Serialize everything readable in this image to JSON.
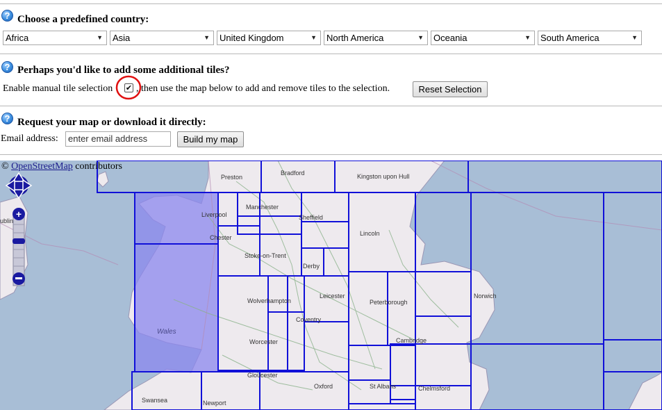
{
  "section1": {
    "title": "Choose a predefined country:"
  },
  "countries": [
    {
      "label": "Africa"
    },
    {
      "label": "Asia"
    },
    {
      "label": "United Kingdom"
    },
    {
      "label": "North America"
    },
    {
      "label": "Oceania"
    },
    {
      "label": "South America"
    }
  ],
  "section2": {
    "title": "Perhaps you'd like to add some additional tiles?",
    "manual_label": "Enable manual tile selection",
    "manual_checked": true,
    "after_text": ", then use the map below to add and remove tiles to the selection.",
    "reset_label": "Reset Selection"
  },
  "section3": {
    "title": "Request your map or download it directly:",
    "email_label": "Email address:",
    "email_placeholder": "enter email address",
    "build_label": "Build my map"
  },
  "map": {
    "attribution_prefix": "©",
    "attribution_link": "OpenStreetMap",
    "attribution_suffix": "contributors",
    "places": [
      {
        "name": "Bradford"
      },
      {
        "name": "Preston"
      },
      {
        "name": "Kingston upon Hull"
      },
      {
        "name": "Manchester"
      },
      {
        "name": "Liverpool"
      },
      {
        "name": "Sheffield"
      },
      {
        "name": "Chester"
      },
      {
        "name": "Lincoln"
      },
      {
        "name": "Stoke-on-Trent"
      },
      {
        "name": "Derby"
      },
      {
        "name": "Leicester"
      },
      {
        "name": "Wolverhampton"
      },
      {
        "name": "Norwich"
      },
      {
        "name": "Peterborough"
      },
      {
        "name": "Coventry"
      },
      {
        "name": "Wales"
      },
      {
        "name": "Worcester"
      },
      {
        "name": "Cambridge"
      },
      {
        "name": "Gloucester"
      },
      {
        "name": "Oxford"
      },
      {
        "name": "St Albans"
      },
      {
        "name": "Chelmsford"
      },
      {
        "name": "Swansea"
      },
      {
        "name": "Newport"
      },
      {
        "name": "ublin"
      }
    ],
    "colors": {
      "sea": "#a8bed6",
      "land": "#eeeaee",
      "selected": "#8b87ee",
      "grid": "#1010d8"
    }
  }
}
